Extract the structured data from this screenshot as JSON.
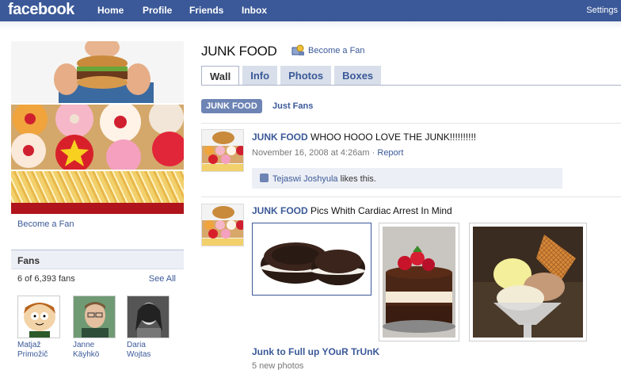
{
  "topbar": {
    "logo": "facebook",
    "nav": [
      "Home",
      "Profile",
      "Friends",
      "Inbox"
    ],
    "settings": "Settings"
  },
  "sidebar": {
    "become_fan": "Become a Fan",
    "fans_title": "Fans",
    "fans_count": "6 of 6,393 fans",
    "see_all": "See All",
    "fans": [
      {
        "name_line1": "Matjaž",
        "name_line2": "Primožič"
      },
      {
        "name_line1": "Janne",
        "name_line2": "Käyhkö"
      },
      {
        "name_line1": "Daria",
        "name_line2": "Wojtas"
      }
    ]
  },
  "page": {
    "title": "JUNK FOOD",
    "become_fan": "Become a Fan",
    "tabs": [
      "Wall",
      "Info",
      "Photos",
      "Boxes"
    ],
    "active_tab": "Wall",
    "filter_active": "JUNK FOOD",
    "filter_other": "Just Fans"
  },
  "posts": [
    {
      "author": "JUNK FOOD",
      "text": " WHOO HOOO LOVE THE JUNK!!!!!!!!!!",
      "date": "November 16, 2008 at 4:26am",
      "dot": " · ",
      "report": "Report",
      "liker": "Tejaswi Joshyula",
      "likes_suffix": " likes this."
    },
    {
      "author": "JUNK FOOD",
      "text": " Pics Whith Cardiac Arrest In Mind",
      "album_title": "Junk to Full up YOuR TrUnK",
      "album_count": "5 new photos"
    }
  ],
  "colors": {
    "brand": "#3b5998",
    "pill": "#6d84b4",
    "tab_bg": "#d8dfea"
  }
}
